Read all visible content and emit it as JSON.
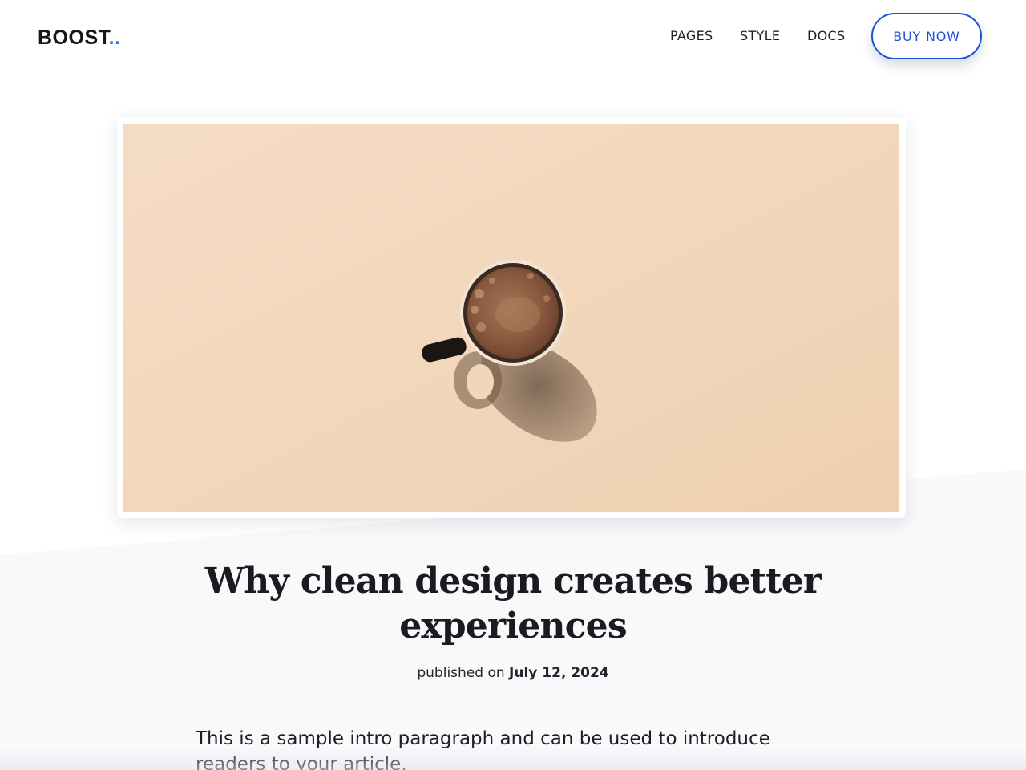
{
  "header": {
    "logo_text": "BOOST",
    "logo_dots": "..",
    "nav": [
      {
        "label": "PAGES"
      },
      {
        "label": "STYLE"
      },
      {
        "label": "DOCS"
      }
    ],
    "cta_label": "BUY NOW"
  },
  "hero": {
    "image_subject": "coffee-cup"
  },
  "article": {
    "title": "Why clean design creates better experiences",
    "meta_prefix": "published on",
    "date": "July 12, 2024",
    "intro": "This is a sample intro paragraph and can be used to introduce readers to your article."
  },
  "colors": {
    "accent": "#1d52d6",
    "logo_dot": "#2f7cf6",
    "text": "#1b1b1f",
    "image_bg": "#f2d9bf",
    "section_bg": "#f8f9fb"
  }
}
